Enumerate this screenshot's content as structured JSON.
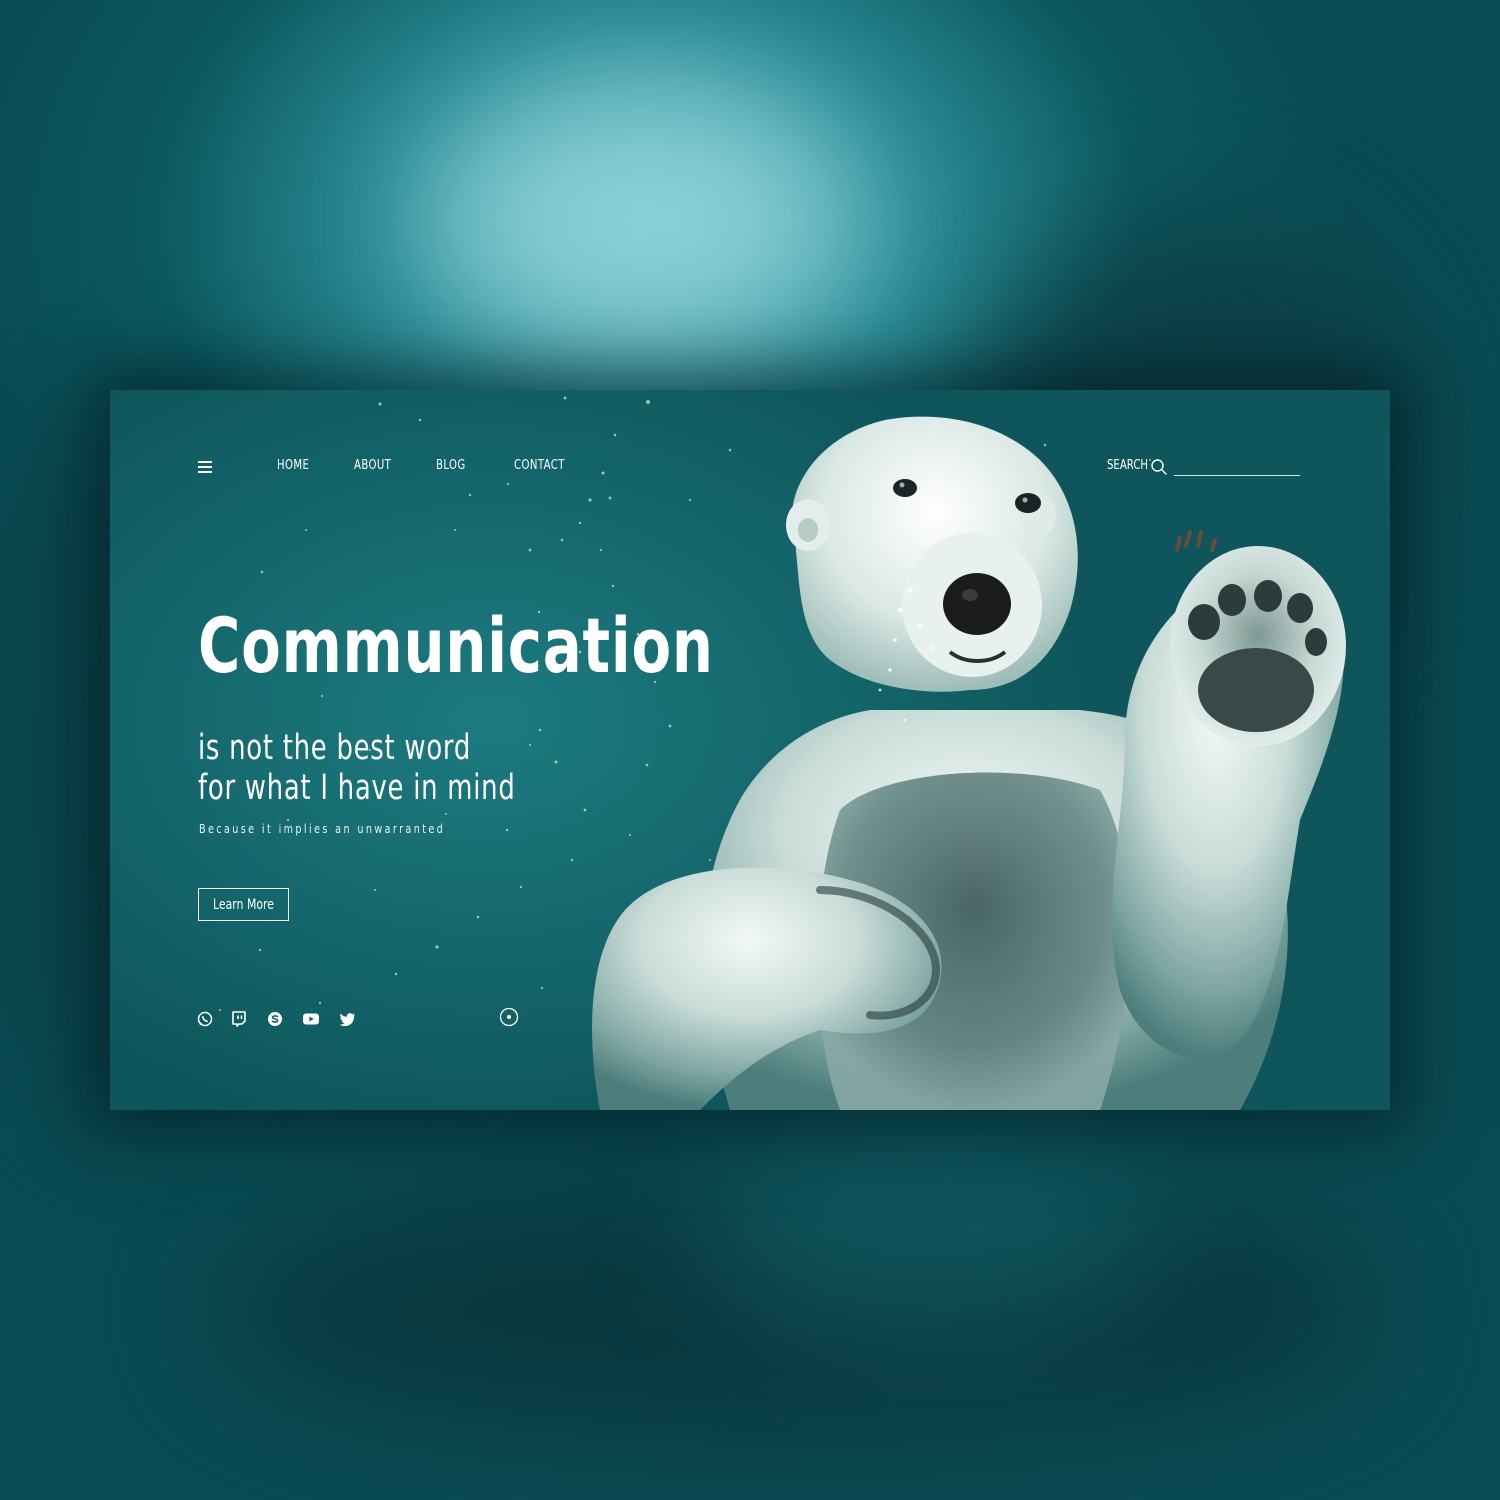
{
  "nav": {
    "menu_icon": "hamburger-menu-icon",
    "links": [
      "HOME",
      "ABOUT",
      "BLOG",
      "CONTACT"
    ],
    "search_label": "SEARCH",
    "search_icon": "search-icon",
    "search_value": ""
  },
  "hero": {
    "title": "Communication",
    "subtitle_line1": "is not the best word",
    "subtitle_line2": "for what I have in mind",
    "caption": "Because it implies an unwarranted",
    "button_label": "Learn More"
  },
  "social": [
    "whatsapp-icon",
    "twitch-icon",
    "skype-icon",
    "youtube-icon",
    "twitter-icon"
  ],
  "colors": {
    "page_background": "#0b4f57",
    "card_background": "#14676c",
    "text": "#ffffff"
  }
}
